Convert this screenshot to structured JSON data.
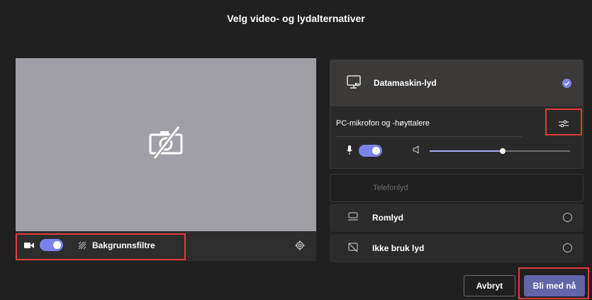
{
  "dialog": {
    "title": "Velg video- og lydalternativer"
  },
  "preview": {
    "camera_off_icon": "camera-off-icon",
    "camera_toggle_on": true,
    "background_filters_label": "Bakgrunnsfiltre",
    "settings_icon": "gear-icon"
  },
  "audio": {
    "computer_audio_label": "Datamaskin-lyd",
    "computer_audio_selected": true,
    "device_label": "PC-mikrofon og -høyttalere",
    "mic_toggle_on": true,
    "speaker_volume_fraction": 0.52,
    "phone_audio_label": "Telefonlyd",
    "room_audio_label": "Romlyd",
    "no_audio_label": "Ikke bruk lyd"
  },
  "footer": {
    "cancel_label": "Avbryt",
    "join_label": "Bli med nå"
  },
  "colors": {
    "accent": "#6264a7",
    "toggle": "#7b83eb",
    "highlight": "#e23b3b"
  }
}
